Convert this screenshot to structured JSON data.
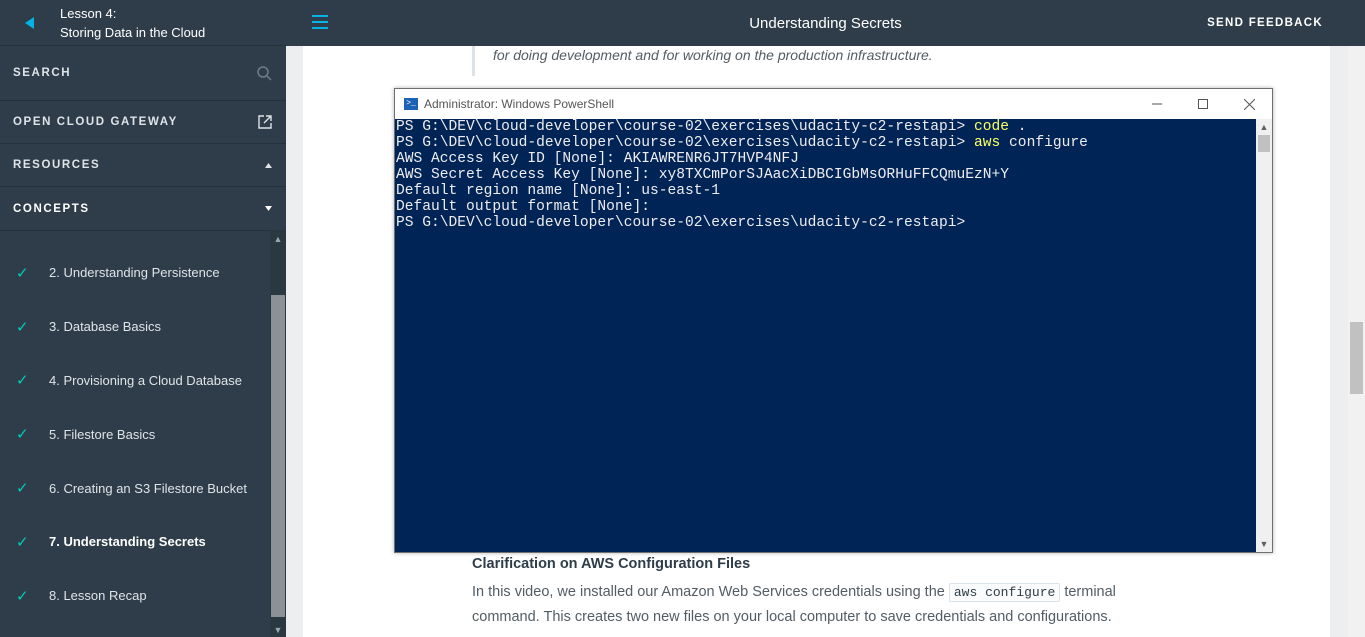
{
  "sidebar": {
    "lesson_label": "Lesson 4:",
    "lesson_title": "Storing Data in the Cloud",
    "search_label": "SEARCH",
    "gateway_label": "OPEN CLOUD GATEWAY",
    "resources_label": "RESOURCES",
    "concepts_label": "CONCEPTS",
    "concepts": [
      {
        "label": "2. Understanding Persistence"
      },
      {
        "label": "3. Database Basics"
      },
      {
        "label": "4. Provisioning a Cloud Database"
      },
      {
        "label": "5. Filestore Basics"
      },
      {
        "label": "6. Creating an S3 Filestore Bucket"
      },
      {
        "label": "7. Understanding Secrets"
      },
      {
        "label": "8. Lesson Recap"
      }
    ],
    "check_glyph": "✓",
    "accent_color": "#02ccba"
  },
  "header": {
    "title": "Understanding Secrets",
    "feedback_label": "SEND FEEDBACK",
    "menu_icon": "hamburger-icon",
    "accent_color": "#02b3e4"
  },
  "content": {
    "quote": "for doing development and for working on the production infrastructure.",
    "section_title": "Clarification on AWS Configuration Files",
    "body_before": "In this video, we installed our Amazon Web Services credentials using the",
    "body_code": "aws configure",
    "body_after": "terminal command. This creates two new files on your local computer to save credentials and configurations."
  },
  "terminal": {
    "title": "Administrator: Windows PowerShell",
    "background": "#012456",
    "lines": [
      {
        "prompt": "PS G:\\DEV\\cloud-developer\\course-02\\exercises\\udacity-c2-restapi> ",
        "cmd": "code",
        "rest": " ."
      },
      {
        "prompt": "PS G:\\DEV\\cloud-developer\\course-02\\exercises\\udacity-c2-restapi> ",
        "cmd": "aws",
        "rest": " configure"
      },
      {
        "prompt": "AWS Access Key ID [None]: AKIAWRENR6JT7HVP4NFJ",
        "cmd": "",
        "rest": ""
      },
      {
        "prompt": "AWS Secret Access Key [None]: xy8TXCmPorSJAacXiDBCIGbMsORHuFFCQmuEzN+Y",
        "cmd": "",
        "rest": ""
      },
      {
        "prompt": "Default region name [None]: us-east-1",
        "cmd": "",
        "rest": ""
      },
      {
        "prompt": "Default output format [None]:",
        "cmd": "",
        "rest": ""
      },
      {
        "prompt": "PS G:\\DEV\\cloud-developer\\course-02\\exercises\\udacity-c2-restapi>",
        "cmd": "",
        "rest": ""
      }
    ]
  }
}
